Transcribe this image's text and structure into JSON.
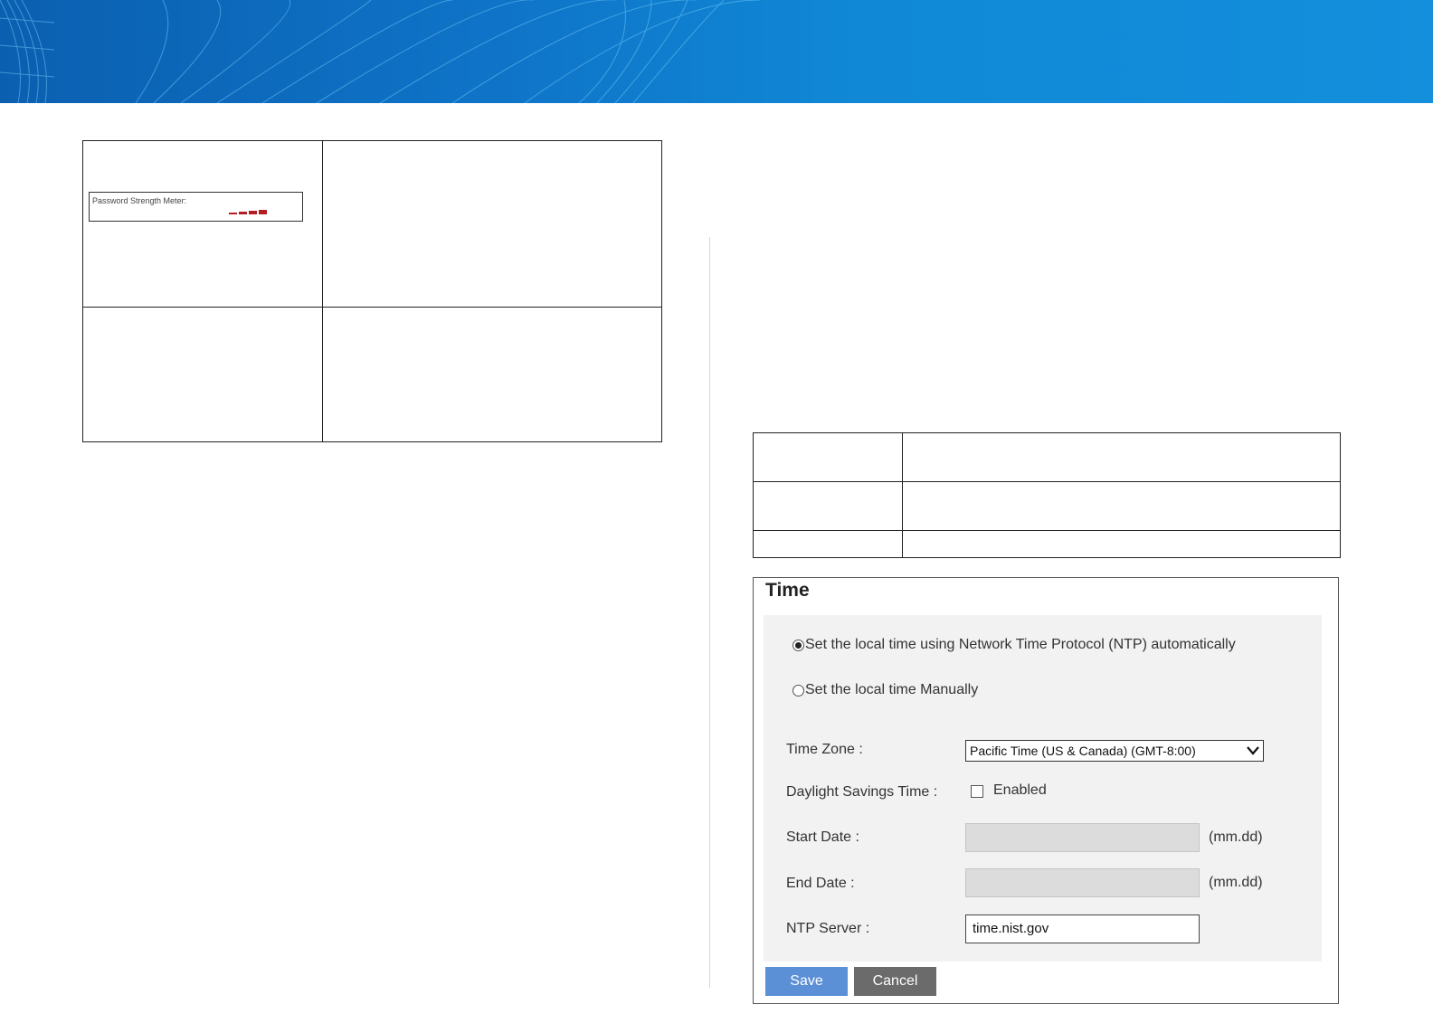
{
  "colors": {
    "banner": "#0f74c8",
    "strength_bar": "#b51d25",
    "save_button": "#5b8fd6",
    "cancel_button": "#6b6b6b",
    "panel_background": "#f2f2f2"
  },
  "password_meter": {
    "label": "Password Strength Meter:",
    "bars": 4
  },
  "time_panel": {
    "title": "Time",
    "options": [
      {
        "label": "Set the local time using Network Time Protocol (NTP) automatically",
        "selected": true
      },
      {
        "label": "Set the local time Manually",
        "selected": false
      }
    ],
    "time_zone": {
      "label": "Time Zone :",
      "value": "Pacific Time (US & Canada) (GMT-8:00)"
    },
    "dst": {
      "label": "Daylight Savings Time :",
      "checkbox_label": "Enabled",
      "checked": false
    },
    "start_date": {
      "label": "Start Date :",
      "value": "",
      "unit": "(mm.dd)"
    },
    "end_date": {
      "label": "End Date :",
      "value": "",
      "unit": "(mm.dd)"
    },
    "ntp_server": {
      "label": "NTP Server :",
      "value": "time.nist.gov"
    },
    "save_label": "Save",
    "cancel_label": "Cancel"
  }
}
